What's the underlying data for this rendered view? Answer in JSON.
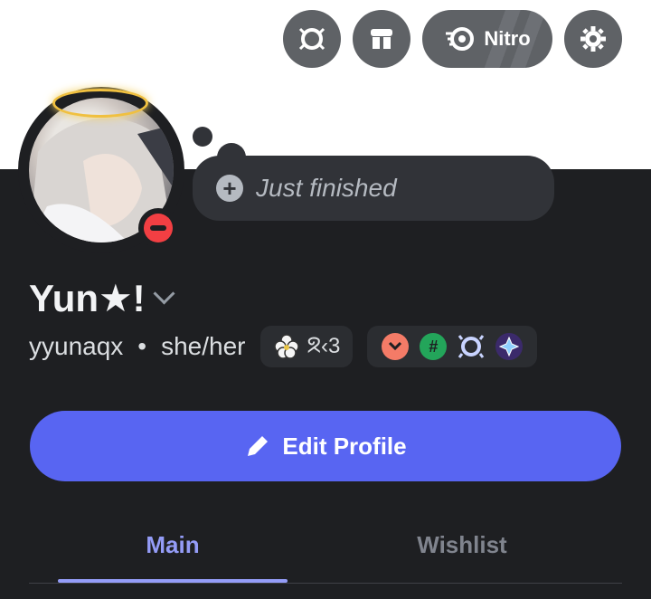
{
  "header": {
    "buttons": [
      {
        "icon": "badge-laurel-icon"
      },
      {
        "icon": "shop-icon"
      },
      {
        "icon": "nitro-icon",
        "label": "Nitro"
      },
      {
        "icon": "gear-icon"
      }
    ]
  },
  "profile": {
    "display_name": "Yun★!",
    "username": "yyunaqx",
    "separator": "•",
    "pronouns": "she/her",
    "status_indicator": "do-not-disturb",
    "custom_status": "Just finished",
    "tag": "ᘝ‹3",
    "badges": [
      "chevron-badge-icon",
      "hashtag-badge-icon",
      "laurel-badge-icon",
      "quest-badge-icon"
    ]
  },
  "actions": {
    "edit_profile": "Edit Profile"
  },
  "tabs": {
    "main": "Main",
    "wishlist": "Wishlist",
    "active": "Main"
  },
  "colors": {
    "background": "#1e1f22",
    "accent": "#5865f2",
    "active_tab": "#949cf7",
    "dnd_red": "#f23f43"
  }
}
